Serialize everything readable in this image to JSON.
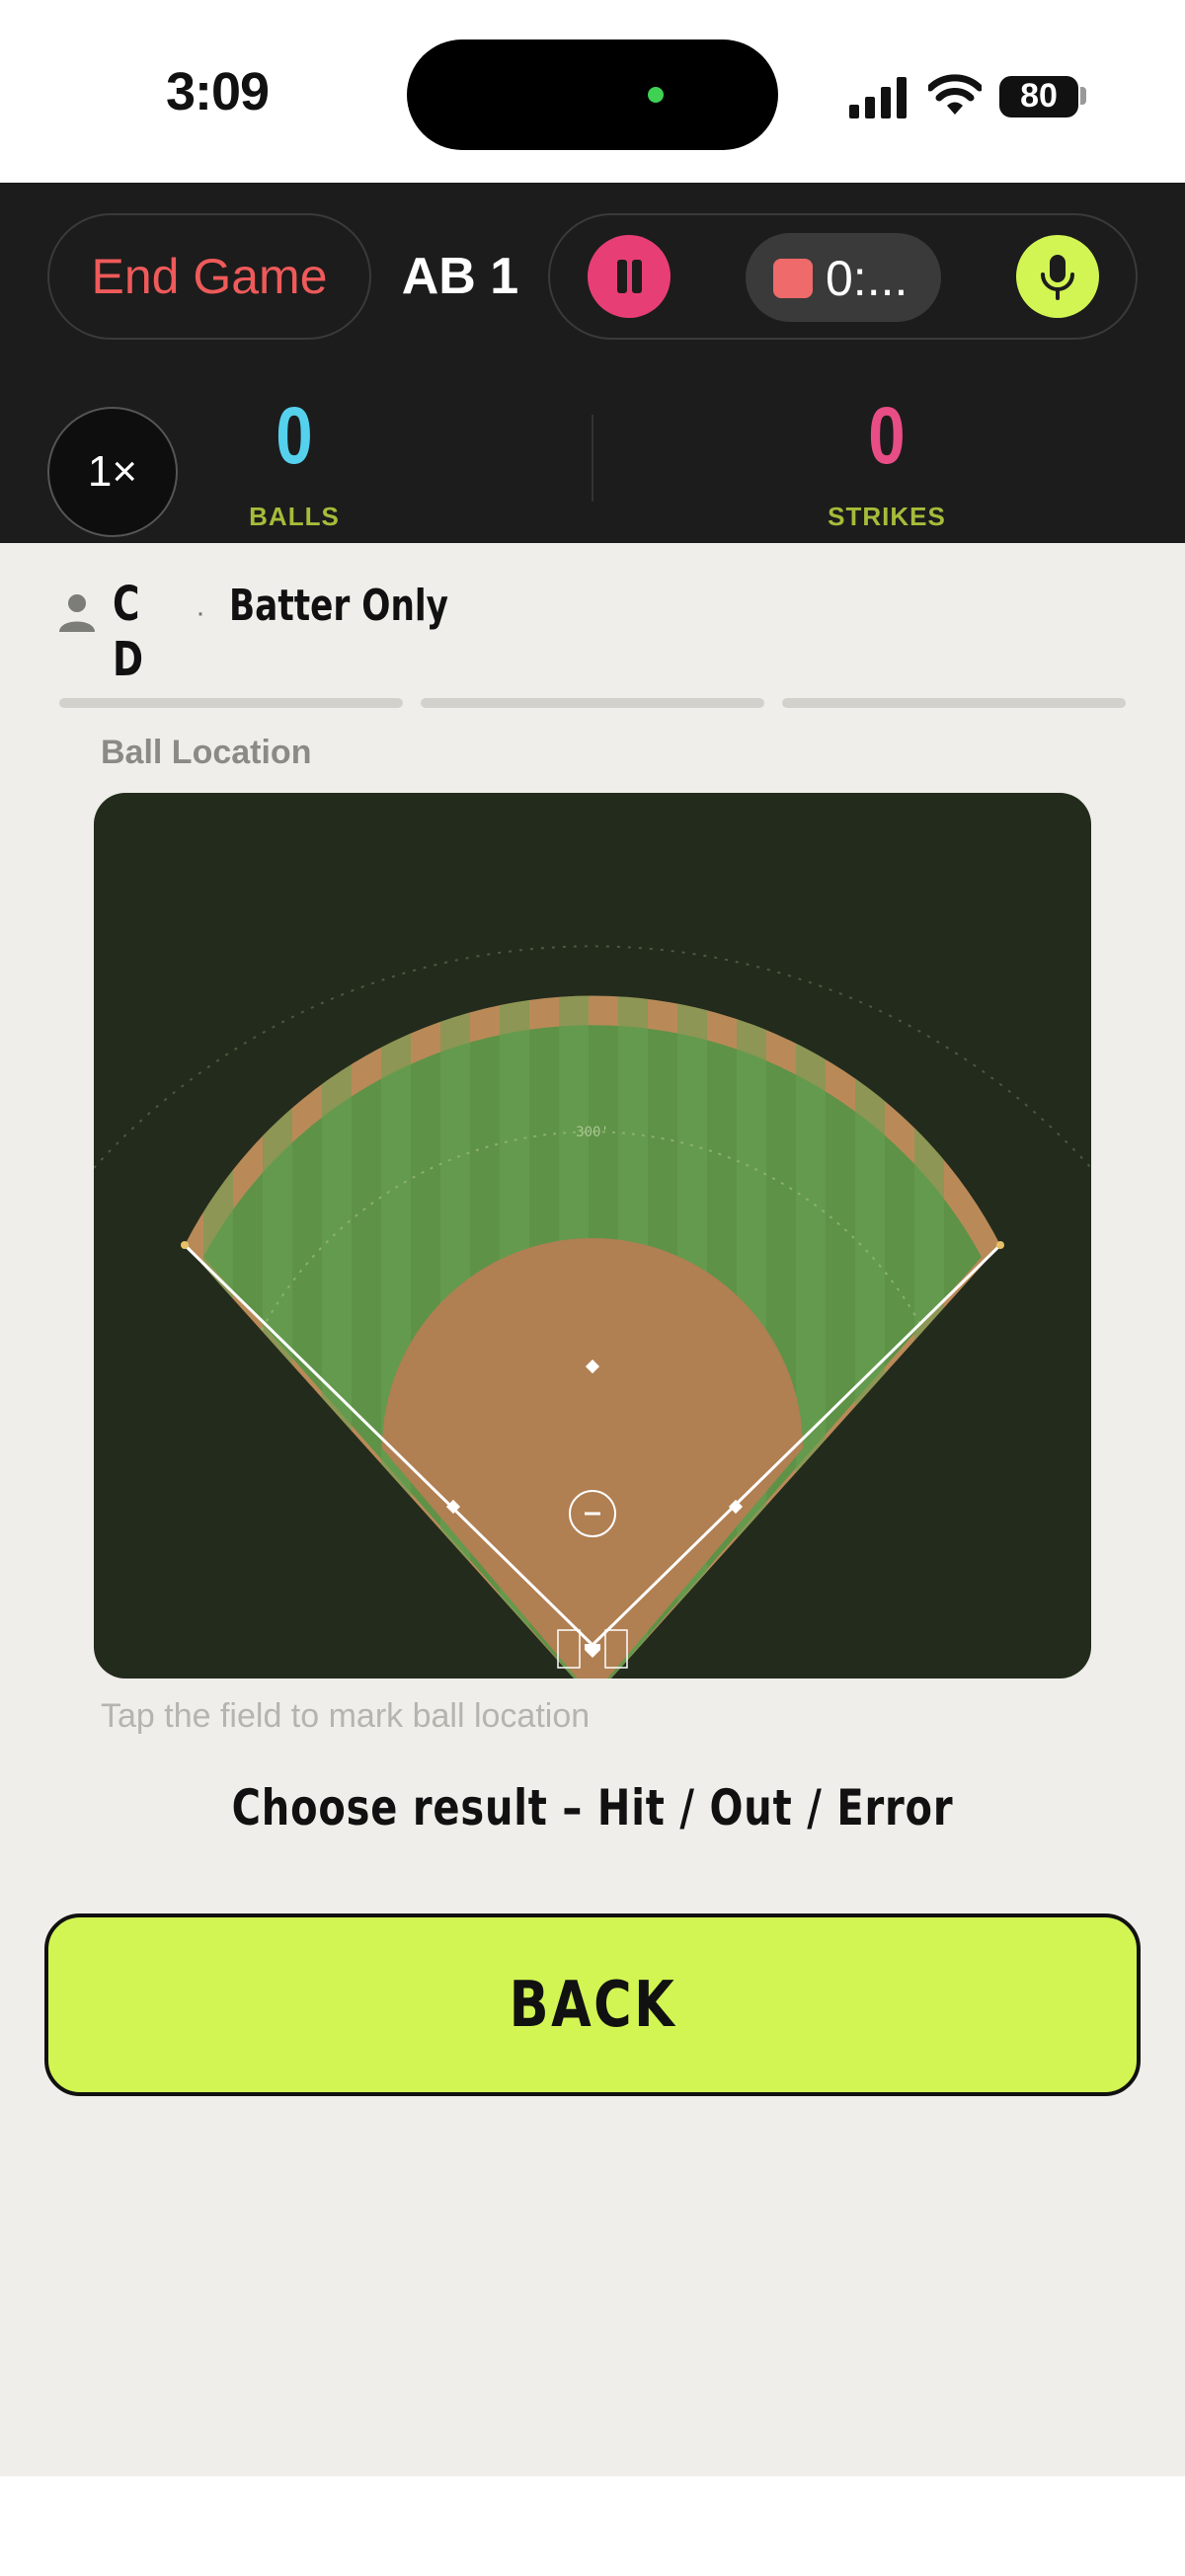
{
  "status_bar": {
    "time": "3:09",
    "battery": "80"
  },
  "header": {
    "end_game_label": "End Game",
    "at_bat_label": "AB 1",
    "recording_time": "0:...",
    "speed_label": "1×",
    "balls": {
      "value": "0",
      "label": "BALLS"
    },
    "strikes": {
      "value": "0",
      "label": "STRIKES"
    }
  },
  "batter": {
    "name": "C D",
    "separator": "·",
    "mode": "Batter Only"
  },
  "steps": {
    "count": 3
  },
  "field": {
    "section_label": "Ball Location",
    "distance_label": "300'",
    "hint": "Tap the field to mark ball location"
  },
  "result": {
    "prompt": "Choose result – Hit / Out / Error"
  },
  "back_button": {
    "label": "BACK"
  },
  "colors": {
    "accent": "#d2f553",
    "balls": "#55d1ee",
    "strikes": "#e84d86",
    "end_game": "#ef5a5a",
    "infield_dirt": "#b07f52",
    "outfield_grass": "#5e9247"
  },
  "icons": [
    "person-icon",
    "pause-icon",
    "stop-icon",
    "microphone-icon",
    "signal-icon",
    "wifi-icon",
    "battery-icon"
  ]
}
